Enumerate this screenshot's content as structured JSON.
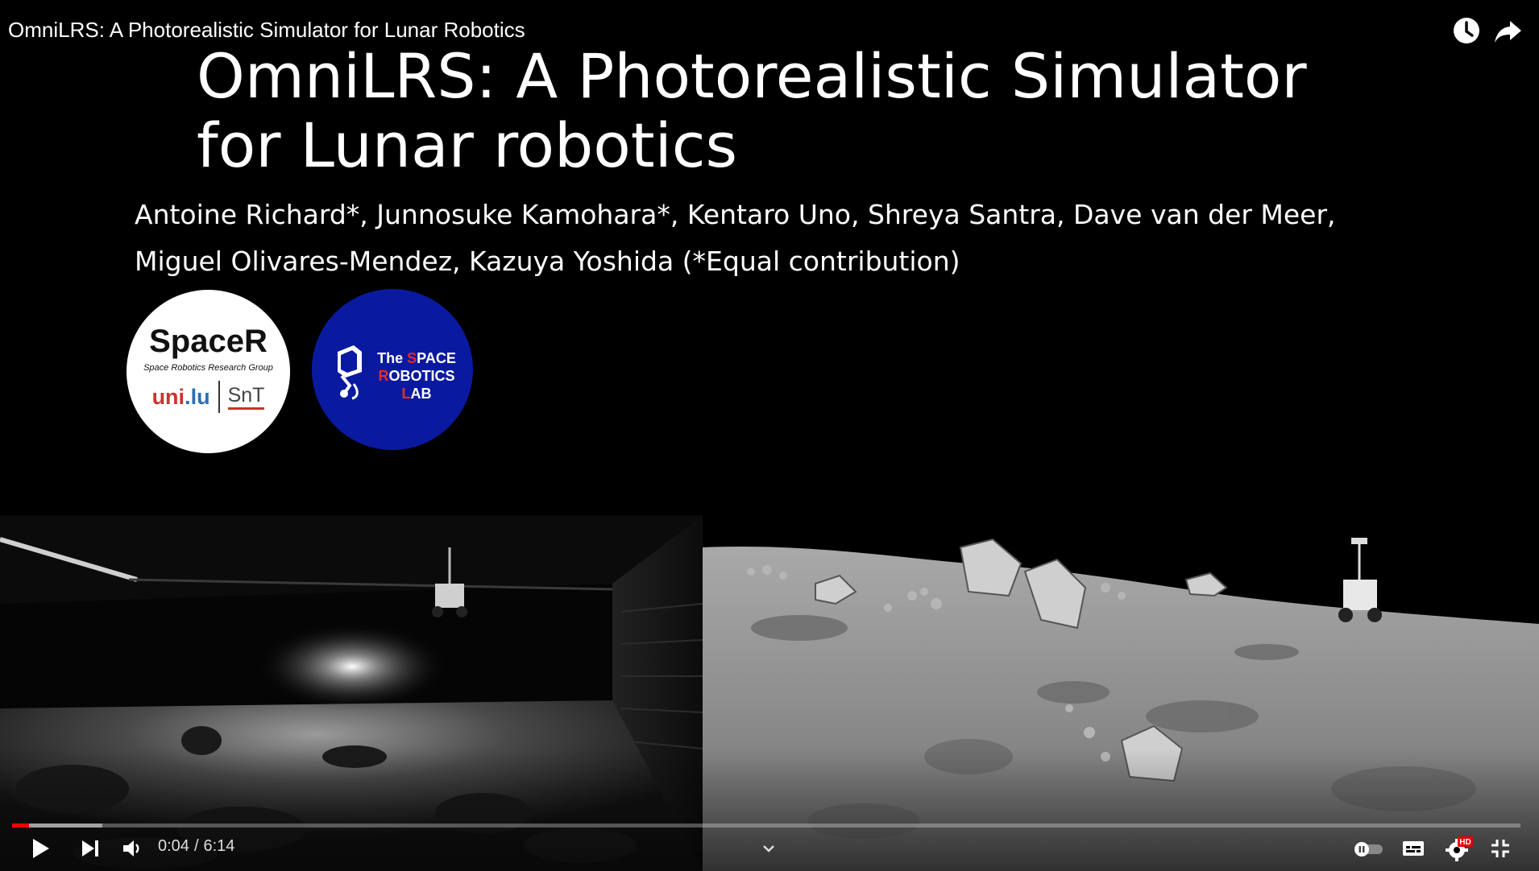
{
  "video": {
    "title": "OmniLRS: A Photorealistic Simulator for Lunar Robotics"
  },
  "slide": {
    "title_line1": "OmniLRS: A Photorealistic Simulator",
    "title_line2": "for Lunar robotics",
    "authors_line1": "Antoine Richard*, Junnosuke Kamohara*, Kentaro Uno, Shreya Santra, Dave van der Meer,",
    "authors_line2": "Miguel Olivares-Mendez, Kazuya Yoshida (*Equal contribution)",
    "logo1": {
      "name": "SpaceR",
      "subtitle": "Space Robotics Research Group",
      "uni_a": "uni",
      "uni_b": ".lu",
      "partner": "SnT"
    },
    "logo2": {
      "line1a": "The ",
      "line1b": "S",
      "line1c": "PACE",
      "line2a": "R",
      "line2b": "OBOTICS",
      "line3a": "L",
      "line3b": "AB"
    }
  },
  "player": {
    "time_current": "0:04",
    "time_separator": "/",
    "time_total": "6:14",
    "progress_played": 0.011,
    "progress_buffered": 0.06,
    "hd_badge": "HD",
    "icons": {
      "watch_later": "clock-icon",
      "share": "share-icon",
      "play": "play-icon",
      "next": "next-icon",
      "volume": "volume-icon",
      "chapters": "chevron-down-icon",
      "autoplay": "autoplay-toggle-icon",
      "subtitles": "subtitles-icon",
      "settings": "gear-icon",
      "exit_fullscreen": "exit-fullscreen-icon"
    },
    "colors": {
      "progress": "#ff0000",
      "hd_badge": "#e00000"
    }
  }
}
